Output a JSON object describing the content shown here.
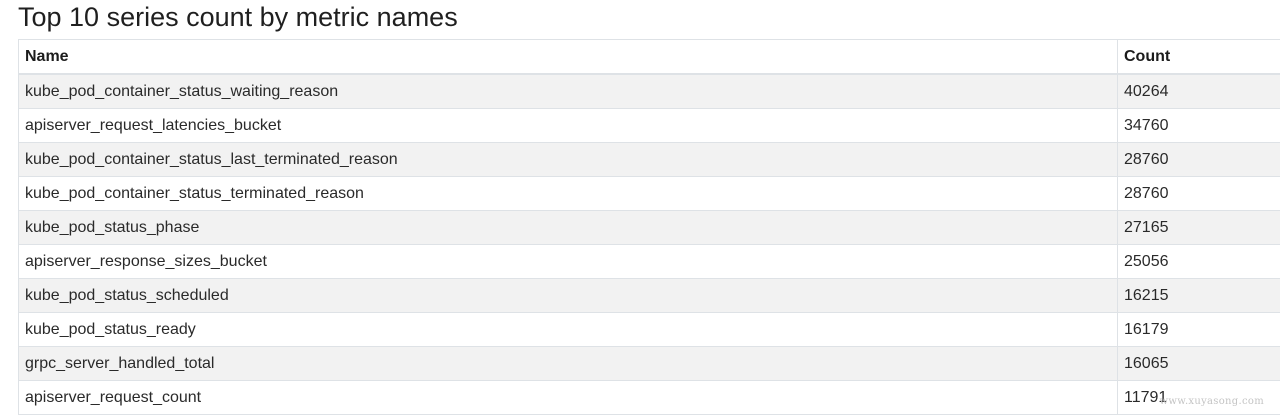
{
  "page": {
    "title": "Top 10 series count by metric names"
  },
  "table": {
    "headers": {
      "name": "Name",
      "count": "Count"
    },
    "rows": [
      {
        "name": "kube_pod_container_status_waiting_reason",
        "count": "40264"
      },
      {
        "name": "apiserver_request_latencies_bucket",
        "count": "34760"
      },
      {
        "name": "kube_pod_container_status_last_terminated_reason",
        "count": "28760"
      },
      {
        "name": "kube_pod_container_status_terminated_reason",
        "count": "28760"
      },
      {
        "name": "kube_pod_status_phase",
        "count": "27165"
      },
      {
        "name": "apiserver_response_sizes_bucket",
        "count": "25056"
      },
      {
        "name": "kube_pod_status_scheduled",
        "count": "16215"
      },
      {
        "name": "kube_pod_status_ready",
        "count": "16179"
      },
      {
        "name": "grpc_server_handled_total",
        "count": "16065"
      },
      {
        "name": "apiserver_request_count",
        "count": "11791"
      }
    ]
  },
  "watermark": {
    "text": "www.xuyasong.com"
  },
  "colors": {
    "stripe": "#f2f2f2",
    "border": "#dee2e6"
  }
}
